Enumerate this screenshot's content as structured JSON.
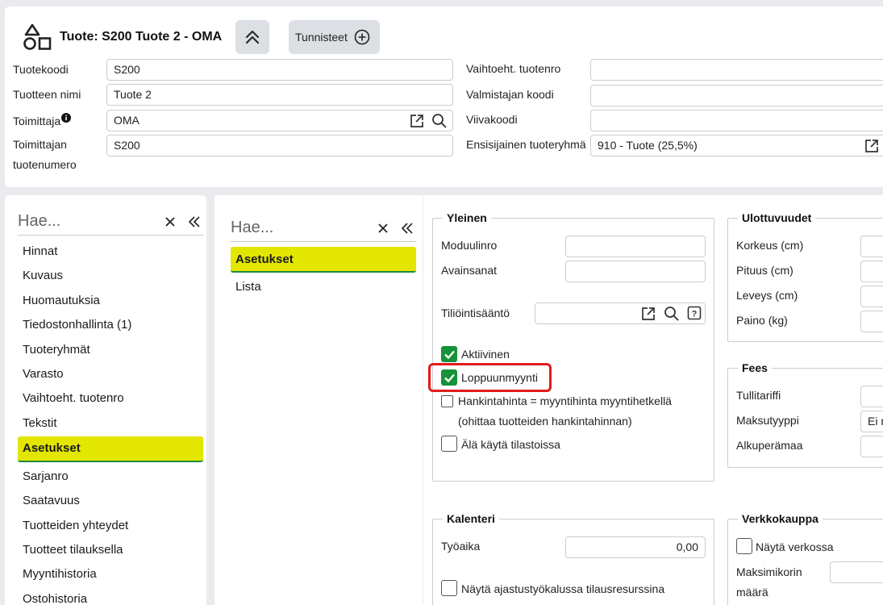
{
  "header": {
    "title": "Tuote: S200 Tuote 2 - OMA",
    "tags_label": "Tunnisteet",
    "left_fields": [
      {
        "label": "Tuotekoodi",
        "value": "S200"
      },
      {
        "label": "Tuotteen nimi",
        "value": "Tuote 2"
      },
      {
        "label": "Toimittaja",
        "value": "OMA"
      },
      {
        "label": "Toimittajan",
        "label2": "tuotenumero",
        "value": "S200"
      }
    ],
    "right_fields": [
      {
        "label": "Vaihtoeht. tuotenro",
        "value": ""
      },
      {
        "label": "Valmistajan koodi",
        "value": ""
      },
      {
        "label": "Viivakoodi",
        "value": ""
      },
      {
        "label": "Ensisijainen tuoteryhmä",
        "value": "910 - Tuote (25,5%)"
      }
    ]
  },
  "left_nav": {
    "search_placeholder": "Hae...",
    "items": [
      {
        "label": "Hinnat"
      },
      {
        "label": "Kuvaus"
      },
      {
        "label": "Huomautuksia"
      },
      {
        "label": "Tiedostonhallinta (1)"
      },
      {
        "label": "Tuoteryhmät"
      },
      {
        "label": "Varasto"
      },
      {
        "label": "Vaihtoeht. tuotenro"
      },
      {
        "label": "Tekstit"
      },
      {
        "label": "Asetukset",
        "active": true
      },
      {
        "label": "Sarjanro"
      },
      {
        "label": "Saatavuus"
      },
      {
        "label": "Tuotteiden yhteydet"
      },
      {
        "label": "Tuotteet tilauksella"
      },
      {
        "label": "Myyntihistoria"
      },
      {
        "label": "Ostohistoria"
      }
    ]
  },
  "mid_nav": {
    "search_placeholder": "Hae...",
    "items": [
      {
        "label": "Asetukset",
        "active": true
      },
      {
        "label": "Lista"
      }
    ]
  },
  "yleinen": {
    "legend": "Yleinen",
    "moduulinro_label": "Moduulinro",
    "moduulinro_value": "",
    "avainsanat_label": "Avainsanat",
    "avainsanat_value": "",
    "tiliointi_label": "Tiliöintisääntö",
    "tiliointi_value": "",
    "aktiivinen_label": "Aktiivinen",
    "aktiivinen_checked": true,
    "loppuunmyynti_label": "Loppuunmyynti",
    "loppuunmyynti_checked": true,
    "hankinta_label": "Hankintahinta = myyntihinta myyntihetkellä",
    "hankinta_label2": "(ohittaa tuotteiden hankintahinnan)",
    "hankinta_checked": false,
    "tilasto_label": "Älä käytä tilastoissa",
    "tilasto_checked": false
  },
  "ulottuvuudet": {
    "legend": "Ulottuvuudet",
    "fields": [
      {
        "label": "Korkeus (cm)",
        "value": ""
      },
      {
        "label": "Pituus (cm)",
        "value": ""
      },
      {
        "label": "Leveys (cm)",
        "value": ""
      },
      {
        "label": "Paino (kg)",
        "value": ""
      }
    ]
  },
  "fees": {
    "legend": "Fees",
    "fields": [
      {
        "label": "Tullitariffi",
        "value": ""
      },
      {
        "label": "Maksutyyppi",
        "value": "Ei m"
      },
      {
        "label": "Alkuperämaa",
        "value": ""
      }
    ]
  },
  "kalenteri": {
    "legend": "Kalenteri",
    "tyoaika_label": "Työaika",
    "tyoaika_value": "0,00",
    "ajastus_label": "Näytä ajastustyökalussa tilausresurssina",
    "ajastus_checked": false
  },
  "verkkokauppa": {
    "legend": "Verkkokauppa",
    "nayta_label": "Näytä verkossa",
    "nayta_checked": false,
    "maksimi_label": "Maksimikorin",
    "maksimi_label2": "määrä",
    "maksimi_value": ""
  }
}
